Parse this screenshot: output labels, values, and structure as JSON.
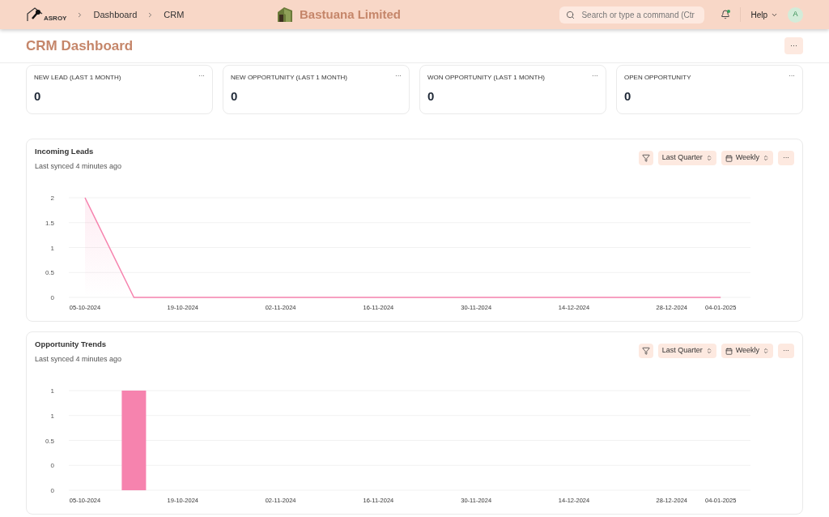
{
  "navbar": {
    "logo_text": "ASROY",
    "breadcrumbs": [
      "Dashboard",
      "CRM"
    ],
    "company": "Bastuana Limited",
    "search": {
      "placeholder": "Search or type a command (Ctr"
    },
    "help": "Help",
    "avatar": "A",
    "notification_dot": true
  },
  "page": {
    "title": "CRM Dashboard",
    "menu": "···"
  },
  "number_cards": [
    {
      "label": "NEW LEAD (LAST 1 MONTH)",
      "value": "0",
      "menu": "···"
    },
    {
      "label": "NEW OPPORTUNITY (LAST 1 MONTH)",
      "value": "0",
      "menu": "···"
    },
    {
      "label": "WON OPPORTUNITY (LAST 1 MONTH)",
      "value": "0",
      "menu": "···"
    },
    {
      "label": "OPEN OPPORTUNITY",
      "value": "0",
      "menu": "···"
    }
  ],
  "charts": [
    {
      "title": "Incoming Leads",
      "synced": "Last synced 4 minutes ago",
      "range": "Last Quarter",
      "interval": "Weekly",
      "menu": "···",
      "chart_data": {
        "type": "area",
        "categories": [
          "05-10-2024",
          null,
          "19-10-2024",
          null,
          "02-11-2024",
          null,
          "16-11-2024",
          null,
          "30-11-2024",
          null,
          "14-12-2024",
          null,
          "28-12-2024",
          "04-01-2025"
        ],
        "series": [
          {
            "color": "#f683ae",
            "values": [
              2,
              0,
              0,
              0,
              0,
              0,
              0,
              0,
              0,
              0,
              0,
              0,
              0,
              0
            ]
          }
        ],
        "ylim": [
          0,
          2
        ],
        "yticks": [
          0,
          0.5,
          1,
          1.5,
          2
        ],
        "grid": true
      }
    },
    {
      "title": "Opportunity Trends",
      "synced": "Last synced 4 minutes ago",
      "range": "Last Quarter",
      "interval": "Weekly",
      "menu": "···",
      "chart_data": {
        "type": "bar",
        "categories": [
          "05-10-2024",
          null,
          "19-10-2024",
          null,
          "02-11-2024",
          null,
          "16-11-2024",
          null,
          "30-11-2024",
          null,
          "14-12-2024",
          null,
          "28-12-2024",
          "04-01-2025"
        ],
        "series": [
          {
            "color": "#f683ae",
            "values": [
              0,
              1,
              0,
              0,
              0,
              0,
              0,
              0,
              0,
              0,
              0,
              0,
              0,
              0
            ]
          }
        ],
        "ylim": [
          0,
          1
        ],
        "yticks": [
          {
            "value": 0,
            "label": "0"
          },
          {
            "value": 0.25,
            "label": "0"
          },
          {
            "value": 0.5,
            "label": "0.5"
          },
          {
            "value": 0.75,
            "label": "1"
          },
          {
            "value": 1,
            "label": "1"
          }
        ],
        "grid": true
      }
    }
  ]
}
